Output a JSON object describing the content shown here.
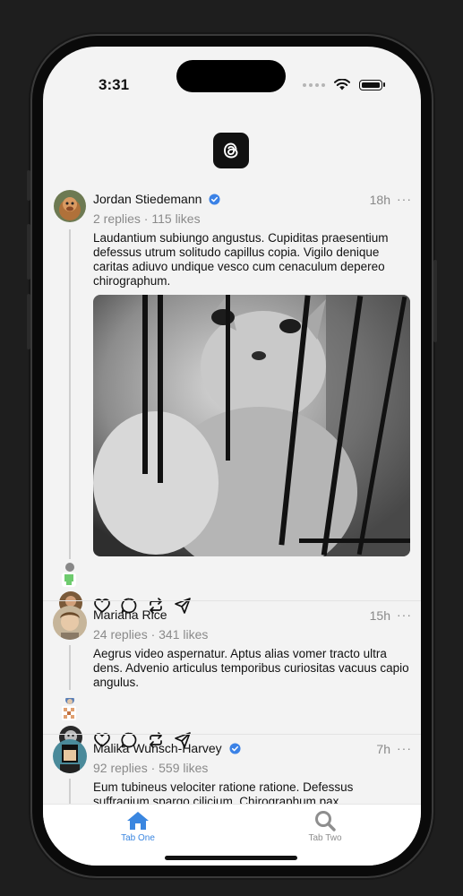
{
  "status": {
    "time": "3:31"
  },
  "posts": [
    {
      "author": "Jordan Stiedemann",
      "verified": true,
      "time": "18h",
      "meta": "2 replies · 115 likes",
      "text": "Laudantium subiungo angustus. Cupiditas praesentium defessus utrum solitudo capillus copia. Vigilo denique caritas adiuvo undique vesco cum cenaculum depereo chirographum.",
      "has_image": true,
      "image": "cat-behind-cage-photo"
    },
    {
      "author": "Mariana Rice",
      "verified": false,
      "time": "15h",
      "meta": "24 replies · 341 likes",
      "text": "Aegrus video aspernatur. Aptus alias vomer tracto ultra dens. Advenio articulus temporibus curiositas vacuus capio angulus.",
      "has_image": false
    },
    {
      "author": "Malika Wunsch-Harvey",
      "verified": true,
      "time": "7h",
      "meta": "92 replies · 559 likes",
      "text": "Eum tubineus velociter ratione ratione. Defessus suffragium spargo cilicium. Chirographum pax",
      "has_image": false
    }
  ],
  "more_icon": "···",
  "tabs": [
    {
      "label": "Tab One",
      "icon": "house-icon",
      "active": true
    },
    {
      "label": "Tab Two",
      "icon": "search-icon",
      "active": false
    }
  ],
  "colors": {
    "accent": "#3a86e0",
    "verified": "#3b82e6",
    "inactive": "#8e8e8e"
  }
}
